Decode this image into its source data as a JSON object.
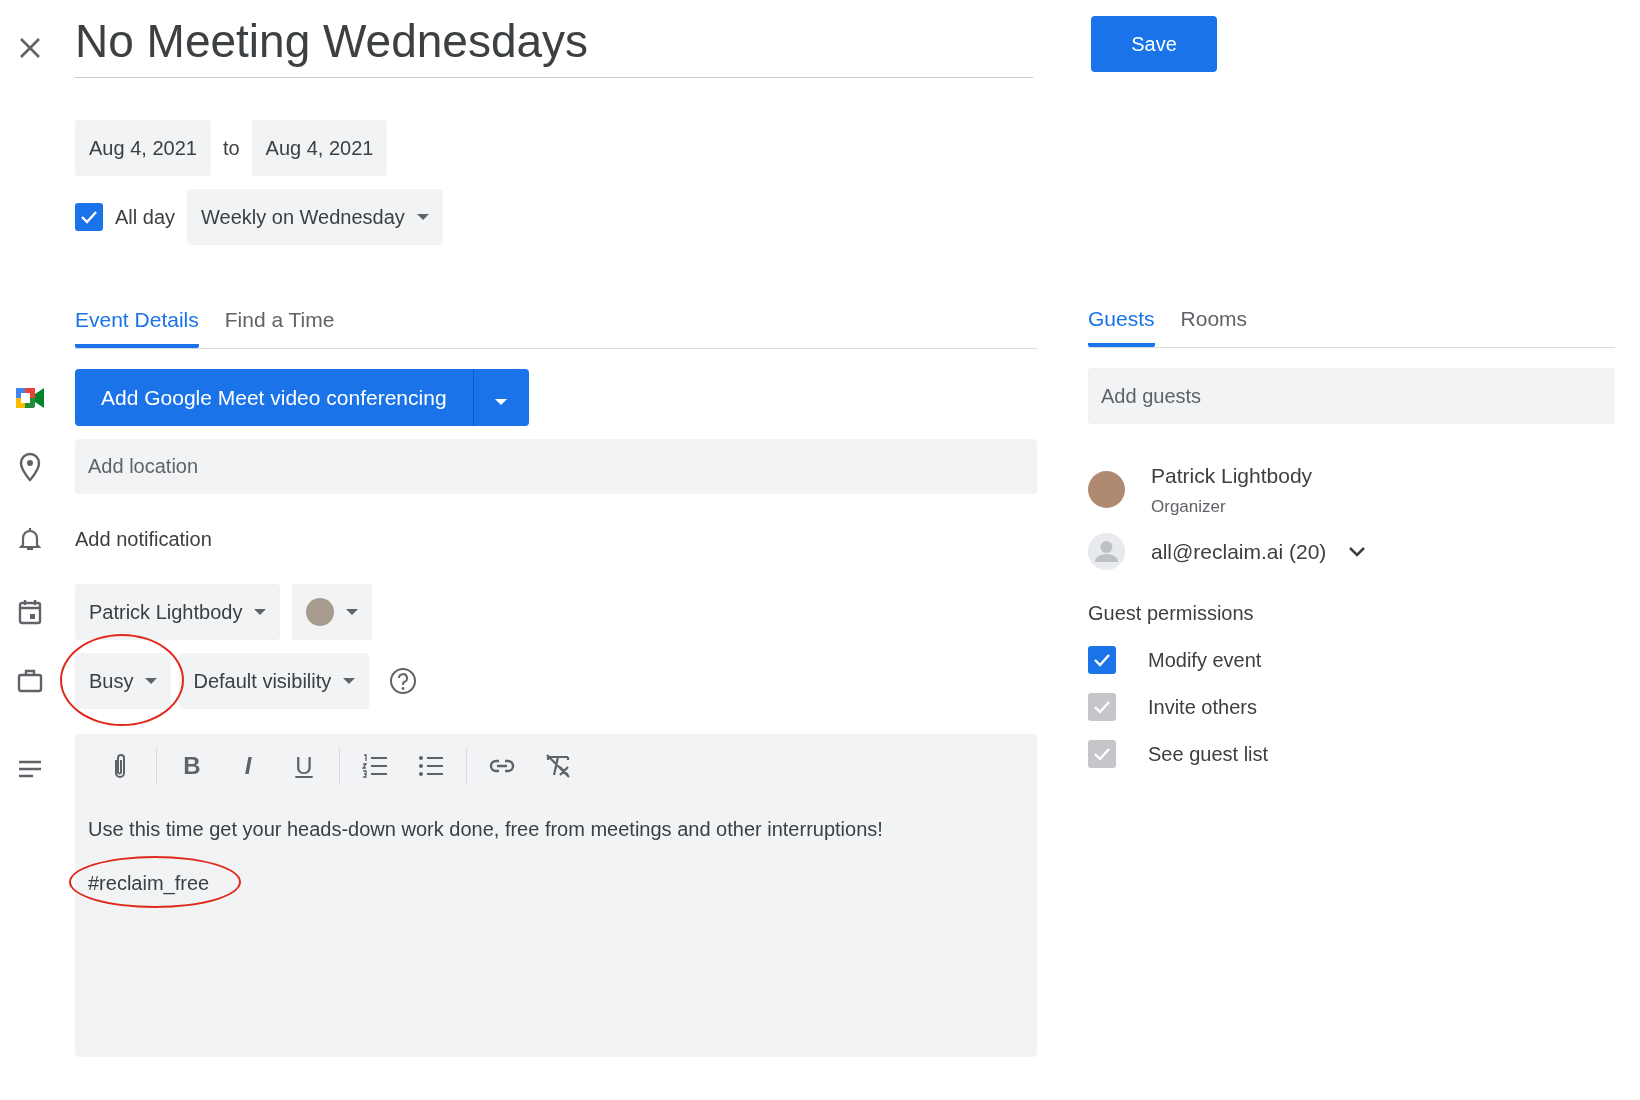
{
  "title": "No Meeting Wednesdays",
  "save_button": "Save",
  "dates": {
    "start": "Aug 4, 2021",
    "separator": "to",
    "end": "Aug 4, 2021"
  },
  "all_day": {
    "label": "All day",
    "checked": true
  },
  "recurrence": "Weekly on Wednesday",
  "tabs": [
    {
      "label": "Event Details",
      "selected": true
    },
    {
      "label": "Find a Time",
      "selected": false
    }
  ],
  "meet_button": "Add Google Meet video conferencing",
  "location": {
    "placeholder": "Add location"
  },
  "notification": "Add notification",
  "calendar": "Patrick Lightbody",
  "availability": {
    "label": "Busy",
    "highlighted": true
  },
  "visibility": "Default visibility",
  "toolbar": [
    {
      "kind": "attach"
    },
    {
      "kind": "divider"
    },
    {
      "kind": "bold",
      "text": "B"
    },
    {
      "kind": "italic",
      "text": "I"
    },
    {
      "kind": "underline",
      "text": "U"
    },
    {
      "kind": "divider"
    },
    {
      "kind": "numbered"
    },
    {
      "kind": "bulleted"
    },
    {
      "kind": "divider"
    },
    {
      "kind": "link"
    },
    {
      "kind": "clear"
    }
  ],
  "description": {
    "text": "Use this time get your heads-down work done, free from meetings and other interruptions!",
    "tag": "#reclaim_free",
    "tag_highlighted": true
  },
  "guest_tabs": [
    {
      "label": "Guests",
      "selected": true
    },
    {
      "label": "Rooms",
      "selected": false
    }
  ],
  "guests_field": {
    "placeholder": "Add guests"
  },
  "guests": [
    {
      "kind": "photo",
      "name": "Patrick Lightbody",
      "role": "Organizer"
    },
    {
      "kind": "group",
      "name": "all@reclaim.ai (20)",
      "expandable": true
    }
  ],
  "permissions": {
    "title": "Guest permissions",
    "items": [
      {
        "label": "Modify event",
        "checked": true,
        "disabled": false
      },
      {
        "label": "Invite others",
        "checked": true,
        "disabled": true
      },
      {
        "label": "See guest list",
        "checked": true,
        "disabled": true
      }
    ]
  }
}
